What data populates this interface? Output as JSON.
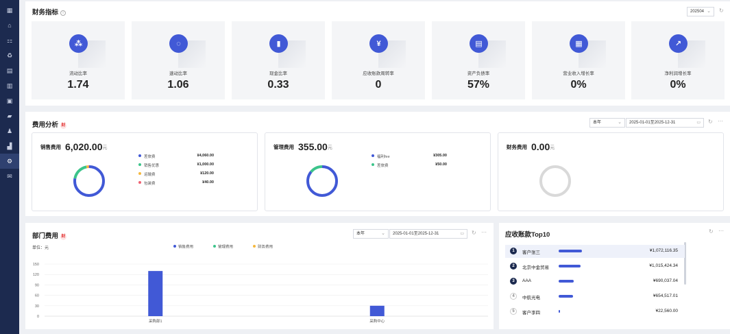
{
  "sidebar": {
    "icons": [
      "grid-icon",
      "home-icon",
      "org-icon",
      "money-icon",
      "receipt-icon",
      "ledger-icon",
      "invoice-icon",
      "folder-icon",
      "people-icon",
      "report-icon",
      "settings-icon",
      "mail-icon"
    ],
    "active_index": 10
  },
  "finance": {
    "title": "财务指标",
    "period": "202504",
    "kpis": [
      {
        "icon": "network-icon",
        "label": "流动比率",
        "value": "1.74"
      },
      {
        "icon": "ring-icon",
        "label": "速动比率",
        "value": "1.06"
      },
      {
        "icon": "bar-chart-icon",
        "label": "现金比率",
        "value": "0.33"
      },
      {
        "icon": "yen-down-icon",
        "label": "应收账款周转率",
        "value": "0"
      },
      {
        "icon": "bill-icon",
        "label": "资产负债率",
        "value": "57%"
      },
      {
        "icon": "store-icon",
        "label": "营业收入增长率",
        "value": "0%"
      },
      {
        "icon": "trend-icon",
        "label": "净利润增长率",
        "value": "0%"
      }
    ]
  },
  "expense": {
    "title": "费用分析",
    "tag": "财",
    "range": "本年",
    "dates": "2025-01-01至2025-12-31",
    "cards": [
      {
        "label": "销售费用",
        "amount": "6,020.00",
        "unit": "元",
        "items": [
          {
            "name": "差旅费",
            "value": "¥4,060.00",
            "color": "#4159d6",
            "share": 0.6744
          },
          {
            "name": "销售优惠",
            "value": "¥1,000.00",
            "color": "#3cc48b",
            "share": 0.1661
          },
          {
            "name": "运输费",
            "value": "¥120.00",
            "color": "#f5b83d",
            "share": 0.0199
          },
          {
            "name": "包装费",
            "value": "¥40.00",
            "color": "#f06273",
            "share": 0.0066
          }
        ]
      },
      {
        "label": "管理费用",
        "amount": "355.00",
        "unit": "元",
        "items": [
          {
            "name": "福利fee",
            "value": "¥305.00",
            "color": "#4159d6",
            "share": 0.859
          },
          {
            "name": "差旅费",
            "value": "¥50.00",
            "color": "#3cc48b",
            "share": 0.141
          }
        ]
      },
      {
        "label": "财务费用",
        "amount": "0.00",
        "unit": "元",
        "items": []
      }
    ]
  },
  "dept": {
    "title": "部门费用",
    "tag": "财",
    "unit_label": "单位：元",
    "range": "本年",
    "dates": "2025-01-01至2025-12-31",
    "legend": [
      {
        "name": "销售费用",
        "color": "#4159d6"
      },
      {
        "name": "管理费用",
        "color": "#3cc48b"
      },
      {
        "name": "财务费用",
        "color": "#f5b83d"
      }
    ]
  },
  "chart_data": {
    "type": "bar",
    "categories": [
      "采购部1",
      "采购中心"
    ],
    "series": [
      {
        "name": "销售费用",
        "values": [
          130,
          30
        ]
      },
      {
        "name": "管理费用",
        "values": [
          0,
          0
        ]
      },
      {
        "name": "财务费用",
        "values": [
          0,
          0
        ]
      }
    ],
    "ylim": [
      0,
      150
    ],
    "yticks": [
      "150",
      "120",
      "90",
      "60",
      "30",
      "0"
    ],
    "grid": true,
    "legend_position": "top"
  },
  "ar": {
    "title": "应收账款Top10",
    "rows": [
      {
        "rank": "1",
        "name": "客户张三",
        "amount": "¥1,072,116.35",
        "share": 1.0
      },
      {
        "rank": "2",
        "name": "北京中金贸易",
        "amount": "¥1,015,424.34",
        "share": 0.947
      },
      {
        "rank": "3",
        "name": "AAA",
        "amount": "¥690,037.04",
        "share": 0.644
      },
      {
        "rank": "4",
        "name": "中航光电",
        "amount": "¥654,517.01",
        "share": 0.61
      },
      {
        "rank": "5",
        "name": "客户李四",
        "amount": "¥22,560.00",
        "share": 0.021
      }
    ]
  }
}
